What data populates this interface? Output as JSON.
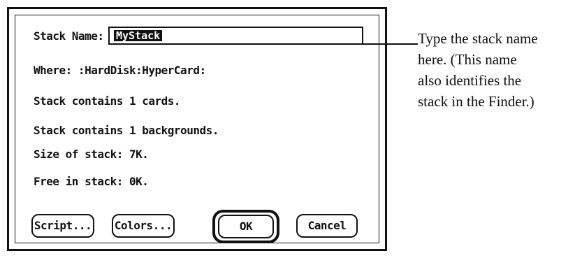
{
  "dialog": {
    "stack_name_label": "Stack Name:",
    "stack_name_value": "MyStack",
    "where": "Where: :HardDisk:HyperCard:",
    "cards": "Stack contains 1 cards.",
    "backgrounds": "Stack contains 1 backgrounds.",
    "size": "Size of stack: 7K.",
    "free": "Free in stack: 0K.",
    "buttons": {
      "script": "Script...",
      "colors": "Colors...",
      "ok": "OK",
      "cancel": "Cancel"
    }
  },
  "callout": {
    "lines": [
      "Type the stack name",
      "here. (This name",
      "also identifies the",
      "stack in the Finder.)"
    ]
  }
}
